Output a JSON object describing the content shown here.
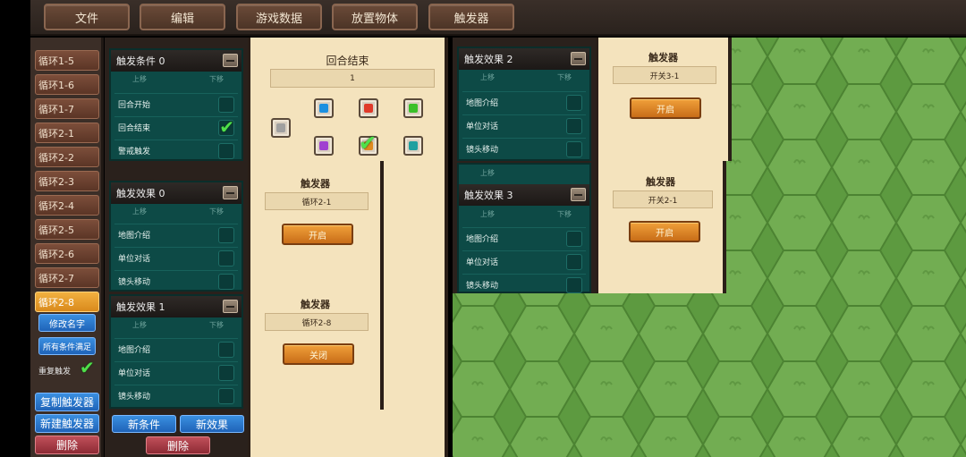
{
  "menu": [
    "文件",
    "编辑",
    "游戏数据",
    "放置物体",
    "触发器"
  ],
  "loops": [
    "循环1-5",
    "循环1-6",
    "循环1-7",
    "循环2-1",
    "循环2-2",
    "循环2-3",
    "循环2-4",
    "循环2-5",
    "循环2-6",
    "循环2-7",
    "循环2-8"
  ],
  "active_loop": "循环2-8",
  "left_actions": {
    "rename": "修改名字",
    "all_conditions": "所有条件满足",
    "repeat_trigger": "重复触发",
    "copy_trigger": "复制触发器",
    "new_trigger": "新建触发器",
    "delete": "删除"
  },
  "condition_panel": {
    "title": "触发条件 0",
    "up": "上移",
    "down": "下移",
    "rows": [
      "回合开始",
      "回合结束",
      "警戒触发"
    ]
  },
  "effect0": {
    "title": "触发效果 0",
    "up": "上移",
    "down": "下移",
    "rows": [
      "地图介绍",
      "单位对话",
      "镜头移动"
    ]
  },
  "effect1": {
    "title": "触发效果 1",
    "up": "上移",
    "down": "下移",
    "rows": [
      "地图介绍",
      "单位对话",
      "镜头移动"
    ]
  },
  "effect2": {
    "title": "触发效果 2",
    "up": "上移",
    "down": "下移",
    "rows": [
      "地图介绍",
      "单位对话",
      "镜头移动"
    ]
  },
  "effect3": {
    "title": "触发效果 3",
    "up": "上移",
    "down": "下移",
    "rows": [
      "地图介绍",
      "单位对话",
      "镜头移动"
    ]
  },
  "bottom_buttons": {
    "new_condition": "新条件",
    "new_effect": "新效果",
    "delete": "删除"
  },
  "round_end_panel": {
    "title": "回合结束",
    "value": "1"
  },
  "gem_colors": {
    "blue": "#1a8fe0",
    "red": "#e03a2a",
    "green": "#3ac02a",
    "gray": "#a0a0a0",
    "purple": "#a040d0",
    "orange": "#e08a20",
    "teal": "#20a0a0"
  },
  "trigger_cards": [
    {
      "title": "触发器",
      "field": "循环2-1",
      "button": "开启"
    },
    {
      "title": "触发器",
      "field": "循环2-8",
      "button": "关闭"
    },
    {
      "title": "触发器",
      "field": "开关3-1",
      "button": "开启"
    },
    {
      "title": "触发器",
      "field": "开关2-1",
      "button": "开启"
    }
  ],
  "colors": {
    "teal_panel": "#0d4a46",
    "parchment": "#f4e3bd",
    "orange_button": "#d98a1c",
    "grass": "#6aa548"
  }
}
